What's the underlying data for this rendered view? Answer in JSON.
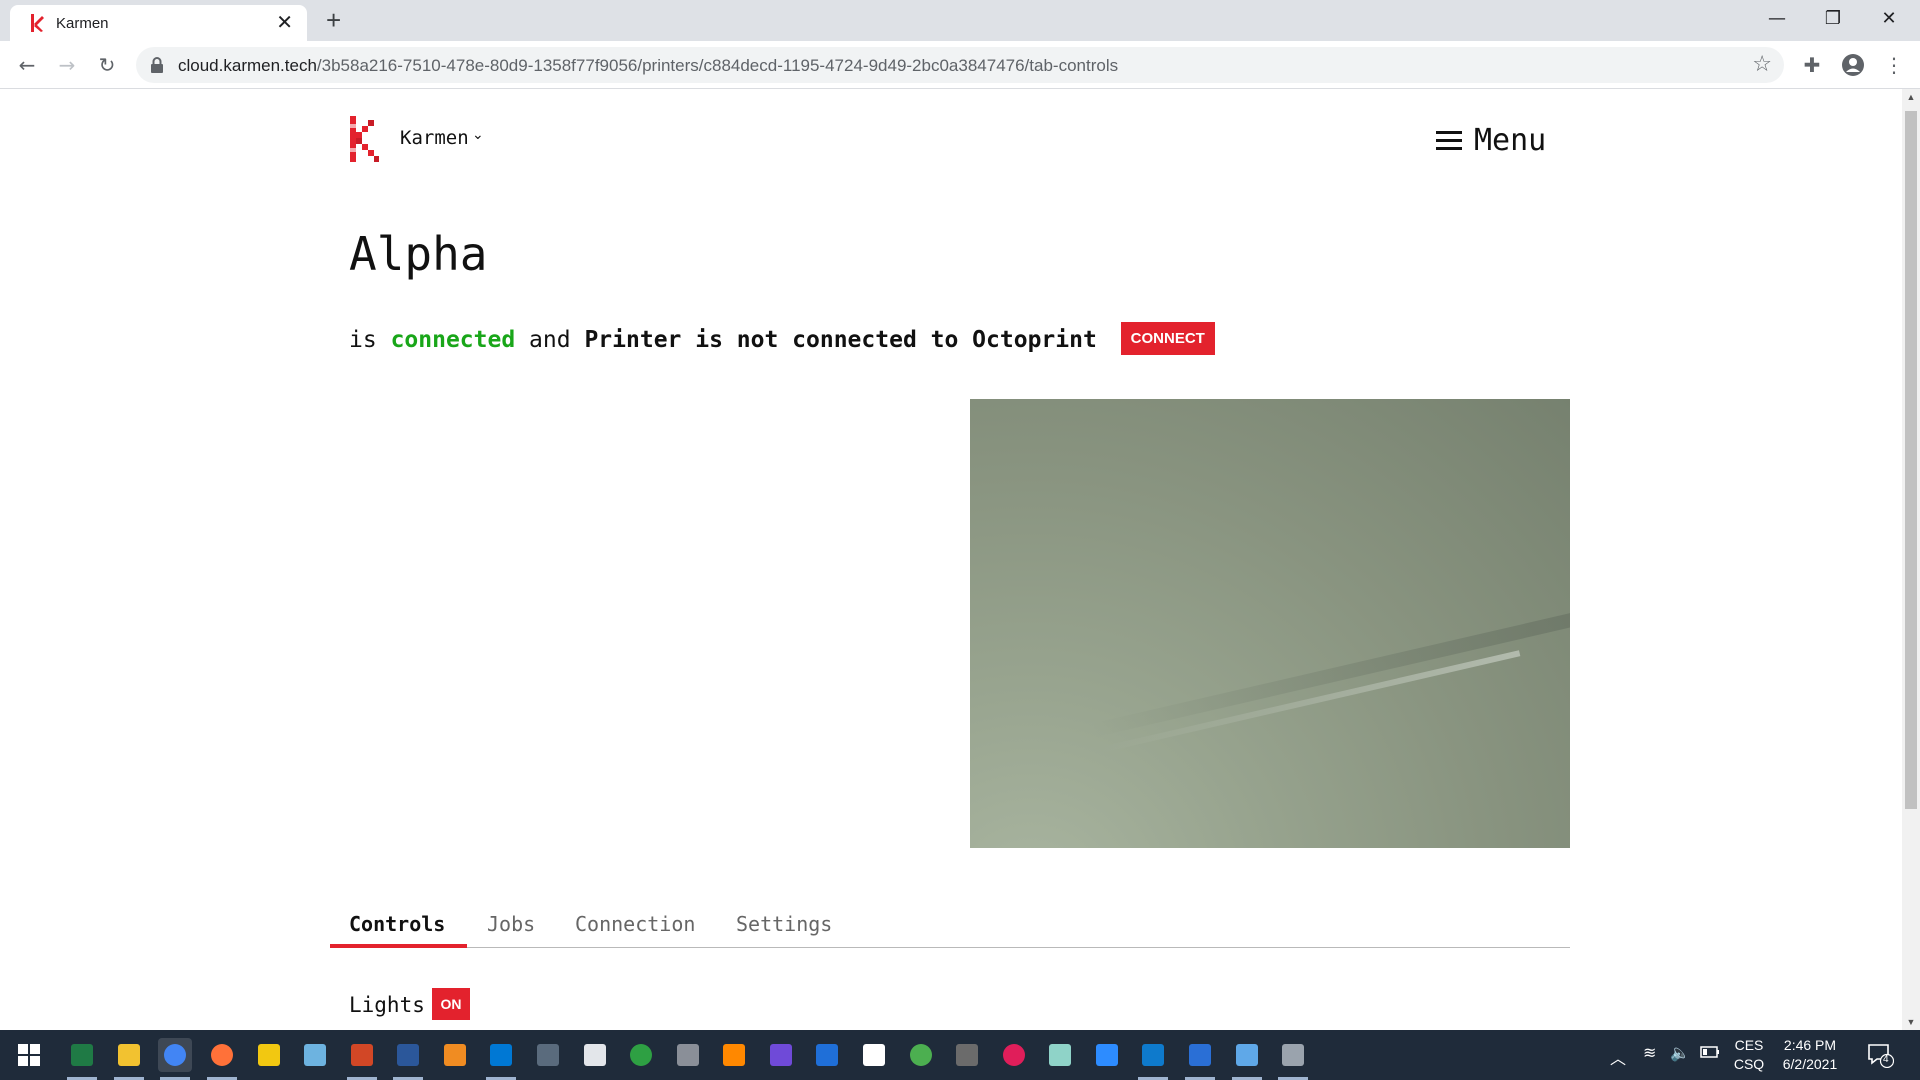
{
  "browser": {
    "tab_title": "Karmen",
    "url_host": "cloud.karmen.tech",
    "url_path": "/3b58a216-7510-478e-80d9-1358f77f9056/printers/c884decd-1195-4724-9d49-2bc0a3847476/tab-controls"
  },
  "header": {
    "brand": "Karmen",
    "menu_label": "Menu"
  },
  "printer": {
    "name": "Alpha",
    "status_prefix": "is",
    "status_connected": "connected",
    "status_and": "and",
    "status_printer": "Printer is not connected to Octoprint",
    "connect_label": "CONNECT"
  },
  "tabs": [
    {
      "label": "Controls",
      "active": true
    },
    {
      "label": "Jobs",
      "active": false
    },
    {
      "label": "Connection",
      "active": false
    },
    {
      "label": "Settings",
      "active": false
    }
  ],
  "controls": {
    "lights_label": "Lights",
    "lights_button": "ON"
  },
  "taskbar": {
    "lang_line1": "CES",
    "lang_line2": "CSQ",
    "time": "2:46 PM",
    "date": "6/2/2021",
    "notification_count": "4",
    "apps": [
      "excel-icon",
      "file-explorer-icon",
      "chrome-icon",
      "firefox-icon",
      "power-bi-icon",
      "paint-icon",
      "powerpoint-icon",
      "word-icon",
      "sublime-text-icon",
      "outlook-icon",
      "calculator-icon",
      "snip-sketch-icon",
      "edge-icon",
      "mouse-app-icon",
      "vlc-icon",
      "davinci-resolve-icon",
      "onedrive-icon",
      "notepad-icon",
      "chrome-beta-icon",
      "movie-maker-icon",
      "slack-icon",
      "notes-icon",
      "zoom-icon",
      "vscode-icon",
      "photos-icon",
      "contacts-icon",
      "remote-desktop-icon"
    ]
  },
  "colors": {
    "accent": "#e3222d",
    "connected": "#19a619",
    "taskbar": "#1f2b3a"
  }
}
